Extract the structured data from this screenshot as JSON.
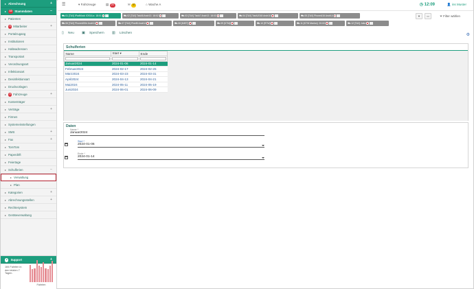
{
  "sidebar": {
    "items": [
      {
        "label": "Abrechnung",
        "style": "green",
        "indicator": "+"
      },
      {
        "label": "Stammdaten",
        "style": "green",
        "indicator": "−",
        "badge": "10"
      },
      {
        "label": "Patienten"
      },
      {
        "label": "Mitarbeiter",
        "badge": "6",
        "indicator": "+"
      },
      {
        "label": "Portalzugang"
      },
      {
        "label": "Institutionen"
      },
      {
        "label": "Halteadressen"
      },
      {
        "label": "Transportart"
      },
      {
        "label": "Verordnungsart"
      },
      {
        "label": "Infektionsart"
      },
      {
        "label": "Desinfektionsart"
      },
      {
        "label": "Druckvorlagen"
      },
      {
        "label": "Fahrzeuge",
        "badge": "8",
        "indicator": "+"
      },
      {
        "label": "Kostenträger"
      },
      {
        "label": "Verträge",
        "indicator": "+"
      },
      {
        "label": "Firmen"
      },
      {
        "label": "Systemeinstellungen"
      },
      {
        "label": "SMS",
        "indicator": "+"
      },
      {
        "label": "Fax",
        "indicator": "+"
      },
      {
        "label": "TomTom"
      },
      {
        "label": "Paperdrift"
      },
      {
        "label": "Feiertage"
      },
      {
        "label": "Schulferien",
        "indicator": "−"
      },
      {
        "label": "Verwaltung",
        "style": "active",
        "sub": true
      },
      {
        "label": "Plan",
        "sub": true
      },
      {
        "label": "Kategorien",
        "indicator": "+"
      },
      {
        "label": "Abrechnungsstellen",
        "indicator": "+"
      },
      {
        "label": "Rechtesystem"
      },
      {
        "label": "Geräteverwaltung"
      }
    ],
    "support": {
      "label": "Support",
      "summary": "184 Fahrten in den letzten 7 Tagen.",
      "chart_caption": "Fahrten",
      "bars": [
        0.75,
        0.55,
        0.6,
        0.95,
        0.7,
        0.65,
        0.85,
        0.6,
        0.55,
        0.7,
        0.9
      ]
    }
  },
  "topbar": {
    "menu_icon": "hamburger-icon",
    "vehicles_label": "Fahrzeuge",
    "vehicles_icon_label": "▾",
    "cars_badge": "25",
    "mail_badge": "47",
    "mail_label": "",
    "wache_label": "Wache A",
    "time": "12:09",
    "user": "ins Muster"
  },
  "chips": {
    "row1": [
      {
        "label": "01 [TAX] iPadMock IOS16.a",
        "time": "18:01",
        "color": "green"
      },
      {
        "label": "02 [TAX] TabA8 Andr13",
        "time": "18:02"
      },
      {
        "label": "03 [TAX] TabA7 Andr13",
        "time": "18:03"
      },
      {
        "label": "04 [TAX] TabA2018 Andr10",
        "time": ""
      },
      {
        "label": "05 [TAX] PhoneA16 Andr14",
        "time": ""
      }
    ],
    "row2": [
      {
        "label": "06 [TAX] PhoneA50e Andr11",
        "time": ""
      },
      {
        "label": "07 [TAX] PixelB Andr14",
        "time": ""
      },
      {
        "label": "08 [MIET]",
        "time": ""
      },
      {
        "label": "09 [KTW]",
        "time": ""
      },
      {
        "label": "10 [RTW]",
        "time": ""
      },
      {
        "label": "11 [KTW Marlon]",
        "time": "20:00"
      },
      {
        "label": "12 [TAX] Julia",
        "time": ""
      }
    ],
    "filter_label": "Filter wählen"
  },
  "toolbar": {
    "new_label": "Neu",
    "save_label": "Speichern",
    "delete_label": "Löschen"
  },
  "grid": {
    "title": "Schulferien",
    "columns": [
      "Name",
      "Start ▾",
      "Ende"
    ],
    "rows": [
      [
        "Januar2024",
        "2024-01-06",
        "2024-01-14"
      ],
      [
        "Februar2024",
        "2024-02-17",
        "2024-02-25"
      ],
      [
        "März2024",
        "2024-03-23",
        "2024-03-31"
      ],
      [
        "April2024",
        "2024-04-13",
        "2024-04-21"
      ],
      [
        "Mai2024",
        "2024-05-11",
        "2024-05-19"
      ],
      [
        "Juni2024",
        "2024-06-01",
        "2024-06-09"
      ]
    ]
  },
  "details": {
    "title": "Daten",
    "name_label": "Name *",
    "name_value": "Januar2024",
    "start_label": "Start *",
    "start_value": "2024-01-06",
    "end_label": "Ende *",
    "end_value": "2024-01-14"
  }
}
